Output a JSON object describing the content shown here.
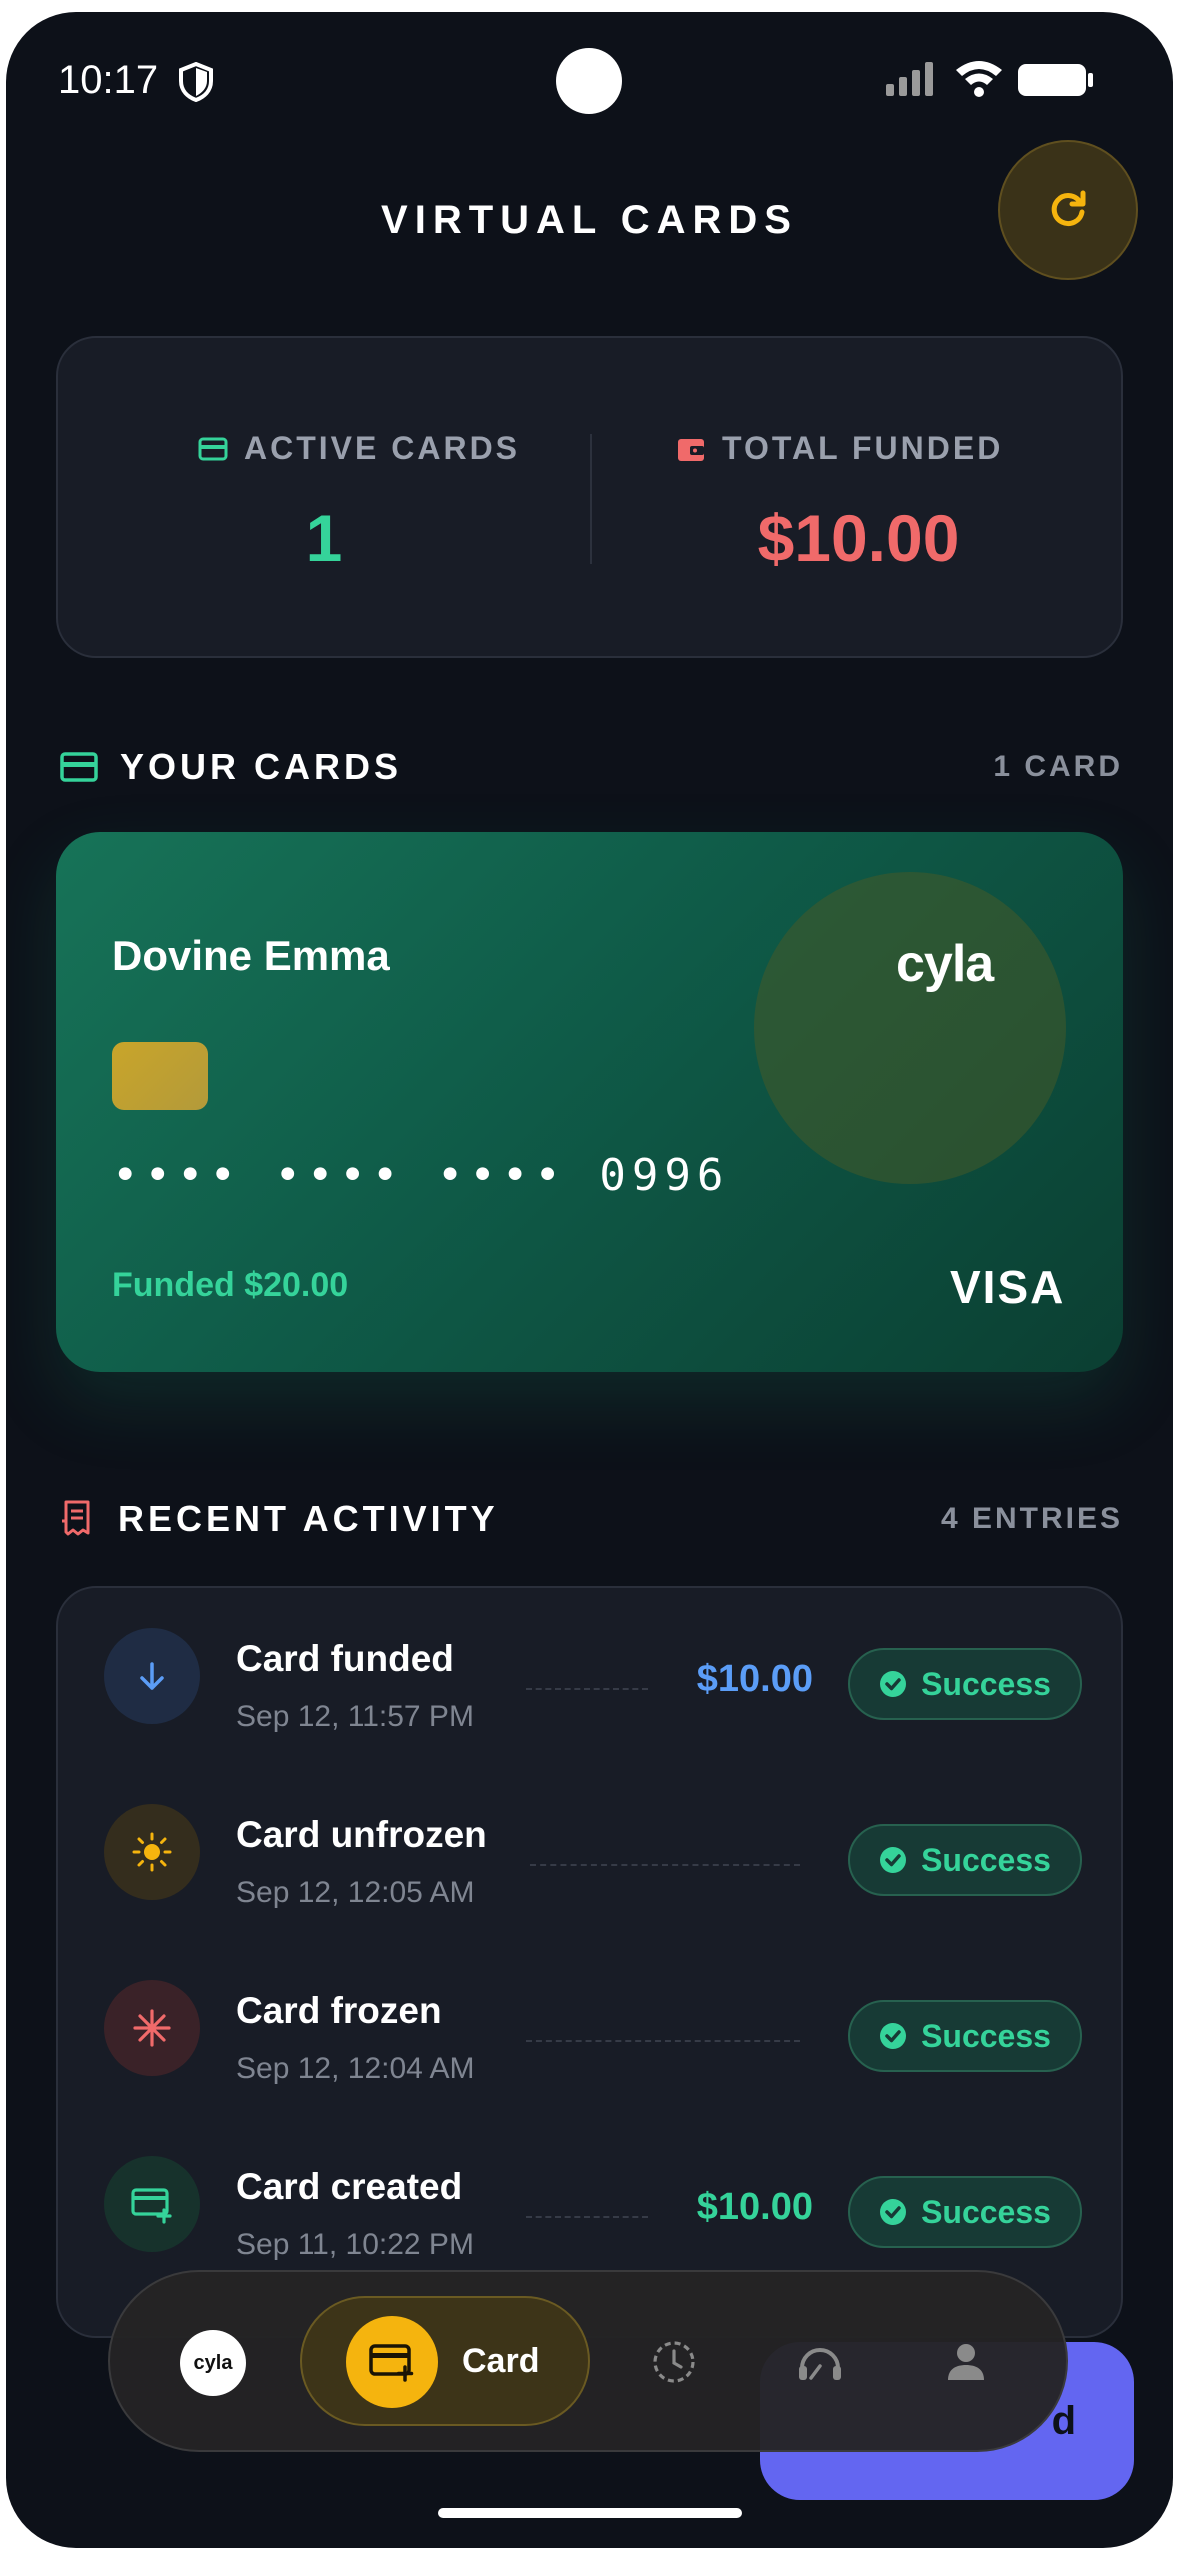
{
  "status_bar": {
    "time": "10:17"
  },
  "header": {
    "title": "VIRTUAL CARDS"
  },
  "stats": {
    "active_label": "ACTIVE CARDS",
    "active_value": "1",
    "funded_label": "TOTAL FUNDED",
    "funded_value": "$10.00"
  },
  "cards_section": {
    "title": "YOUR CARDS",
    "count": "1 CARD"
  },
  "card": {
    "holder": "Dovine Emma",
    "brand": "cyla",
    "masked_number": "•••• •••• •••• 0996",
    "funded": "Funded $20.00",
    "network": "VISA"
  },
  "activity_section": {
    "title": "RECENT ACTIVITY",
    "count": "4 ENTRIES"
  },
  "activity": [
    {
      "title": "Card funded",
      "date": "Sep 12, 11:57 PM",
      "amount": "$10.00",
      "amount_color": "#5b9df7",
      "status": "Success",
      "icon": "arrow-down-icon"
    },
    {
      "title": "Card unfrozen",
      "date": "Sep 12, 12:05 AM",
      "amount": "",
      "amount_color": "",
      "status": "Success",
      "icon": "sun-icon"
    },
    {
      "title": "Card frozen",
      "date": "Sep 12, 12:04 AM",
      "amount": "",
      "amount_color": "",
      "status": "Success",
      "icon": "snowflake-icon"
    },
    {
      "title": "Card created",
      "date": "Sep 11, 10:22 PM",
      "amount": "$10.00",
      "amount_color": "#35d39a",
      "status": "Success",
      "icon": "card-add-icon"
    }
  ],
  "nav": {
    "logo": "cyla",
    "active_label": "Card",
    "fab_label": "d"
  },
  "colors": {
    "background": "#0d1119",
    "accent_green": "#35d39a",
    "accent_red": "#f06a6a",
    "accent_yellow": "#f5b40e",
    "accent_blue": "#5b9df7"
  }
}
